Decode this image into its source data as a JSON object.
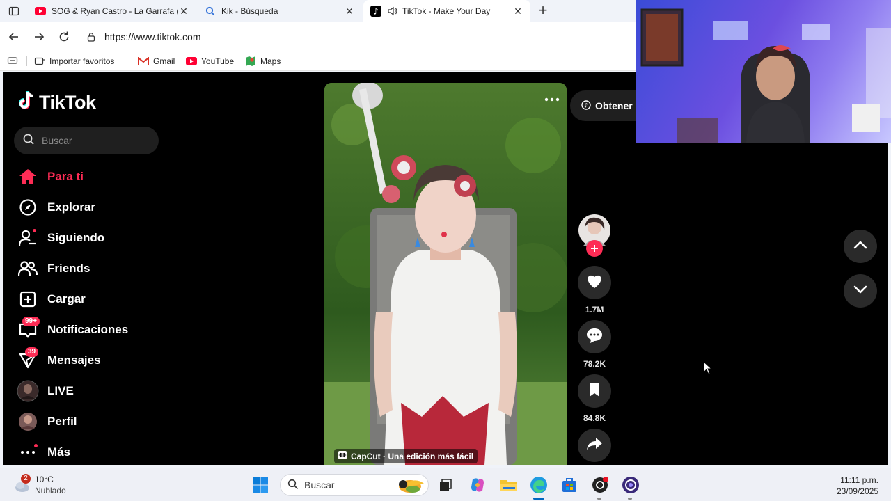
{
  "browser": {
    "tabs": [
      {
        "title": "SOG & Ryan Castro - La Garrafa (Of",
        "favicon": "youtube-icon",
        "active": false
      },
      {
        "title": "Kik - Búsqueda",
        "favicon": "search-icon",
        "active": false
      },
      {
        "title": "TikTok - Make Your Day",
        "favicon": "tiktok-icon",
        "active": true
      }
    ],
    "url": "https://www.tiktok.com",
    "bookmarks": [
      "Importar favoritos",
      "Gmail",
      "YouTube",
      "Maps"
    ]
  },
  "tiktok": {
    "brand": "TikTok",
    "search_placeholder": "Buscar",
    "nav": [
      {
        "label": "Para ti",
        "icon": "home-icon",
        "active": true
      },
      {
        "label": "Explorar",
        "icon": "compass-icon"
      },
      {
        "label": "Siguiendo",
        "icon": "following-icon"
      },
      {
        "label": "Friends",
        "icon": "friends-icon"
      },
      {
        "label": "Cargar",
        "icon": "upload-icon"
      },
      {
        "label": "Notificaciones",
        "icon": "inbox-icon",
        "badge": "99+"
      },
      {
        "label": "Mensajes",
        "icon": "message-icon",
        "badge": "39"
      },
      {
        "label": "LIVE",
        "icon": "live-avatar"
      },
      {
        "label": "Perfil",
        "icon": "profile-avatar"
      },
      {
        "label": "Más",
        "icon": "more-icon"
      }
    ],
    "get_app": "Obtener",
    "video_caption": "CapCut · Una edición más fácil",
    "actions": {
      "likes": "1.7M",
      "comments": "78.2K",
      "saves": "84.8K"
    }
  },
  "taskbar": {
    "weather_temp": "10°C",
    "weather_desc": "Nublado",
    "weather_badge": "2",
    "search_placeholder": "Buscar",
    "time": "11:11 p.m.",
    "date": "23/09/2025"
  },
  "colors": {
    "accent": "#fe2c55",
    "page_bg": "#000000",
    "chrome_bg": "#f0f3f9"
  }
}
